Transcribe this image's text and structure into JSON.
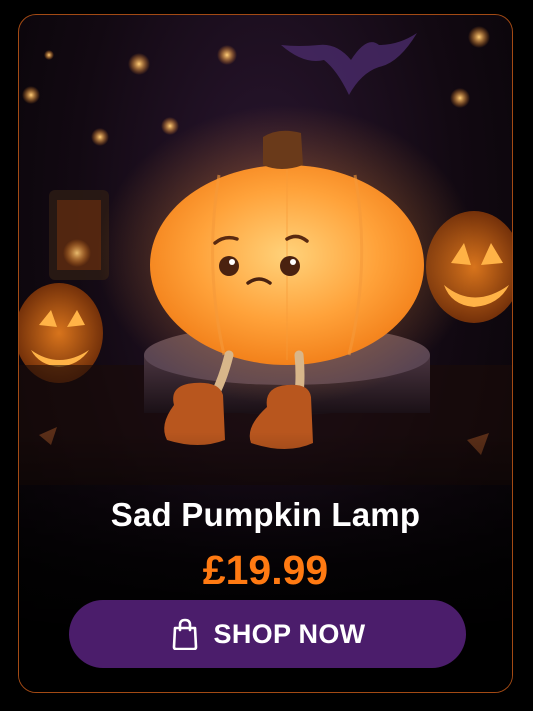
{
  "product": {
    "name": "Sad Pumpkin Lamp",
    "price": "£19.99",
    "cta_label": "SHOP NOW",
    "cta_icon": "shopping-bag-icon"
  },
  "colors": {
    "accent": "#ff7a12",
    "button": "#4b1d6b",
    "border": "#a34a14"
  }
}
